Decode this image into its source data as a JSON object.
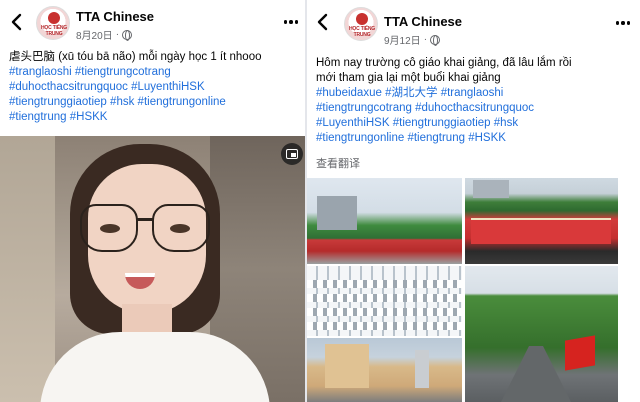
{
  "left_post": {
    "page_name": "TTA Chinese",
    "date": "8月20日",
    "avatar_text": "HỌC TIẾNG TRUNG",
    "caption_lines": [
      [
        {
          "t": "虐头巴脑 (xū tóu bā não) mỗi ngày học 1 ít nhooo",
          "tag": false
        }
      ],
      [
        {
          "t": "#tranglaoshi",
          "tag": true
        },
        {
          "t": " ",
          "tag": false
        },
        {
          "t": "#tiengtrungcotrang",
          "tag": true
        }
      ],
      [
        {
          "t": "#duhocthacsitrungquoc",
          "tag": true
        },
        {
          "t": " ",
          "tag": false
        },
        {
          "t": "#LuyenthiHSK",
          "tag": true
        }
      ],
      [
        {
          "t": "#tiengtrunggiaotiep",
          "tag": true
        },
        {
          "t": " ",
          "tag": false
        },
        {
          "t": "#hsk",
          "tag": true
        },
        {
          "t": " ",
          "tag": false
        },
        {
          "t": "#tiengtrungonline",
          "tag": true
        }
      ],
      [
        {
          "t": "#tiengtrung",
          "tag": true
        },
        {
          "t": " ",
          "tag": false
        },
        {
          "t": "#HSKK",
          "tag": true
        }
      ]
    ]
  },
  "right_post": {
    "page_name": "TTA Chinese",
    "date": "9月12日",
    "avatar_text": "HỌC TIẾNG TRUNG",
    "caption_lines": [
      [
        {
          "t": "Hôm nay trường cô giáo khai giảng, đã lâu lắm rồi",
          "tag": false
        }
      ],
      [
        {
          "t": "mới tham gia lại một buổi khai giảng",
          "tag": false
        }
      ],
      [
        {
          "t": "#hubeidaxue",
          "tag": true
        },
        {
          "t": " ",
          "tag": false
        },
        {
          "t": "#湖北大学",
          "tag": true
        },
        {
          "t": " ",
          "tag": false
        },
        {
          "t": "#tranglaoshi",
          "tag": true
        }
      ],
      [
        {
          "t": "#tiengtrungcotrang",
          "tag": true
        },
        {
          "t": " ",
          "tag": false
        },
        {
          "t": "#duhocthacsitrungquoc",
          "tag": true
        }
      ],
      [
        {
          "t": "#LuyenthiHSK",
          "tag": true
        },
        {
          "t": " ",
          "tag": false
        },
        {
          "t": "#tiengtrunggiaotiep",
          "tag": true
        },
        {
          "t": " ",
          "tag": false
        },
        {
          "t": "#hsk",
          "tag": true
        }
      ],
      [
        {
          "t": "#tiengtrungonline",
          "tag": true
        },
        {
          "t": " ",
          "tag": false
        },
        {
          "t": "#tiengtrung",
          "tag": true
        },
        {
          "t": " ",
          "tag": false
        },
        {
          "t": "#HSKK",
          "tag": true
        }
      ]
    ],
    "translate_label": "查看翻译"
  },
  "icons": {
    "back": "chevron-left-icon",
    "more": "more-horizontal-icon",
    "privacy": "globe-icon",
    "pip": "picture-in-picture-icon"
  },
  "colors": {
    "hashtag": "#216fdb",
    "meta": "#65676b",
    "text": "#050505"
  }
}
